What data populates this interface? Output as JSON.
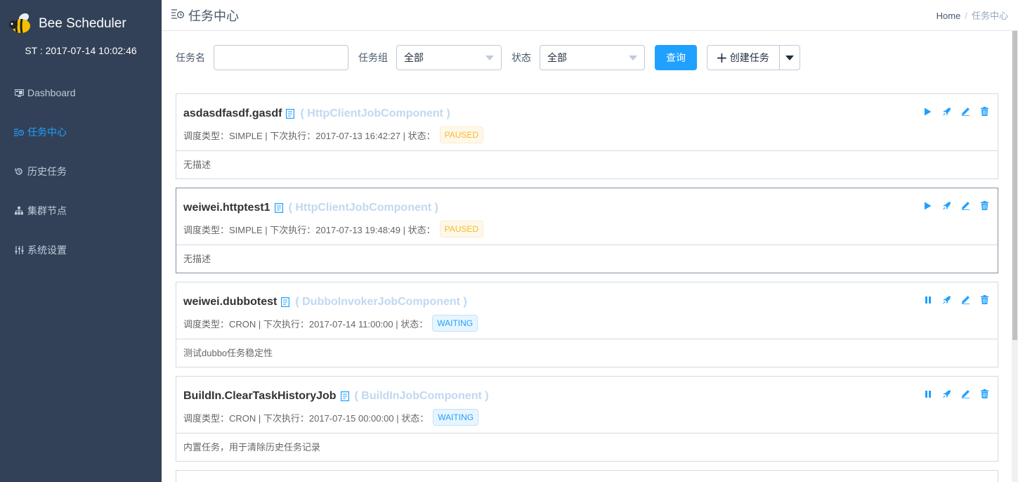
{
  "app": {
    "title": "Bee Scheduler",
    "server_time": "ST : 2017-07-14 10:02:46"
  },
  "sidebar": {
    "items": [
      {
        "label": "Dashboard",
        "icon": "monitor-icon",
        "active": false
      },
      {
        "label": "任务中心",
        "icon": "task-center-icon",
        "active": true
      },
      {
        "label": "历史任务",
        "icon": "history-icon",
        "active": false
      },
      {
        "label": "集群节点",
        "icon": "cluster-icon",
        "active": false
      },
      {
        "label": "系统设置",
        "icon": "settings-sliders-icon",
        "active": false
      }
    ]
  },
  "header": {
    "title": "任务中心",
    "breadcrumb": {
      "home": "Home",
      "sep": "/",
      "current": "任务中心"
    }
  },
  "filters": {
    "name_label": "任务名",
    "name_value": "",
    "group_label": "任务组",
    "group_value": "全部",
    "status_label": "状态",
    "status_value": "全部",
    "query_button": "查询",
    "create_button": "创建任务"
  },
  "jobs": [
    {
      "name": "asdasdfasdf.gasdf",
      "component": "( HttpClientJobComponent )",
      "schedule_type": "SIMPLE",
      "next_run": "2017-07-13 16:42:27",
      "status": "PAUSED",
      "description": "无描述",
      "meta": "调度类型：SIMPLE | 下次执行：2017-07-13 16:42:27 | 状态：",
      "control": "play"
    },
    {
      "name": "weiwei.httptest1",
      "component": "( HttpClientJobComponent )",
      "schedule_type": "SIMPLE",
      "next_run": "2017-07-13 19:48:49",
      "status": "PAUSED",
      "description": "无描述",
      "meta": "调度类型：SIMPLE | 下次执行：2017-07-13 19:48:49 | 状态：",
      "control": "play"
    },
    {
      "name": "weiwei.dubbotest",
      "component": "( DubboInvokerJobComponent )",
      "schedule_type": "CRON",
      "next_run": "2017-07-14 11:00:00",
      "status": "WAITING",
      "description": "测试dubbo任务稳定性",
      "meta": "调度类型：CRON | 下次执行：2017-07-14 11:00:00 | 状态：",
      "control": "pause"
    },
    {
      "name": "BuildIn.ClearTaskHistoryJob",
      "component": "( BuildInJobComponent )",
      "schedule_type": "CRON",
      "next_run": "2017-07-15 00:00:00",
      "status": "WAITING",
      "description": "内置任务，用于清除历史任务记录",
      "meta": "调度类型：CRON | 下次执行：2017-07-15 00:00:00 | 状态：",
      "control": "pause"
    }
  ],
  "colors": {
    "sidebar_bg": "#324157",
    "accent": "#20a0ff",
    "paused": "#f7ba2a",
    "waiting": "#20a0ff"
  }
}
